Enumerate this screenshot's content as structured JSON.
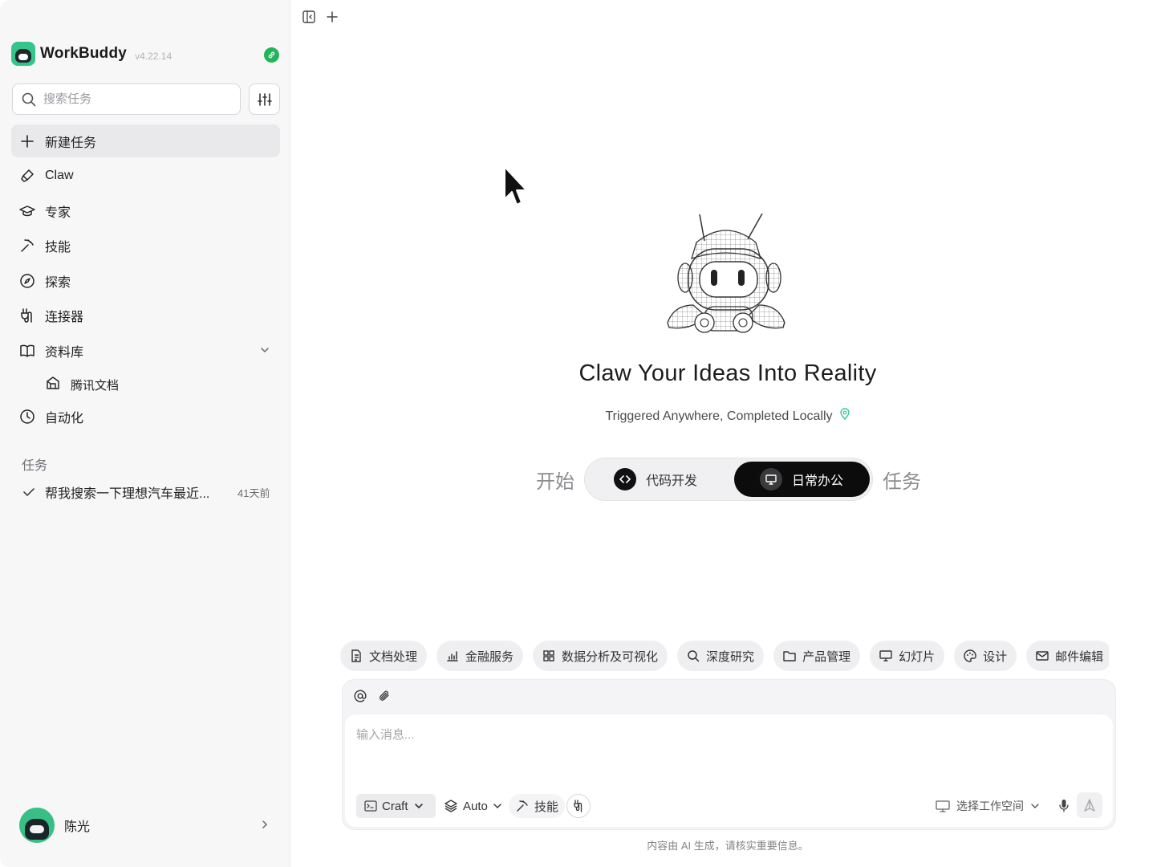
{
  "sidebar": {
    "app_name": "WorkBuddy",
    "version": "v4.22.14",
    "search_placeholder": "搜索任务",
    "nav": {
      "new_task": "新建任务",
      "claw": "Claw",
      "experts": "专家",
      "skills": "技能",
      "explore": "探索",
      "connectors": "连接器",
      "library": "资料库",
      "library_sub": "腾讯文档",
      "automation": "自动化"
    },
    "tasks_section": "任务",
    "tasks": [
      {
        "title": "帮我搜索一下理想汽车最近...",
        "time": "41天前",
        "status": "done"
      }
    ],
    "user_name": "陈光"
  },
  "hero": {
    "title": "Claw Your Ideas Into Reality",
    "subtitle": "Triggered Anywhere, Completed Locally"
  },
  "mode": {
    "prefix": "开始",
    "suffix": "任务",
    "options": [
      "代码开发",
      "日常办公"
    ],
    "selected": "日常办公"
  },
  "chips": [
    "文档处理",
    "金融服务",
    "数据分析及可视化",
    "深度研究",
    "产品管理",
    "幻灯片",
    "设计",
    "邮件编辑"
  ],
  "composer": {
    "placeholder": "输入消息...",
    "craft_label": "Craft",
    "model_label": "Auto",
    "skill_label": "技能",
    "workspace_label": "选择工作空间"
  },
  "disclaimer": "内容由 AI 生成，请核实重要信息。",
  "colors": {
    "brand": "#35c58a",
    "active_mode": "#0c0c0d",
    "connected": "#22b45a"
  }
}
